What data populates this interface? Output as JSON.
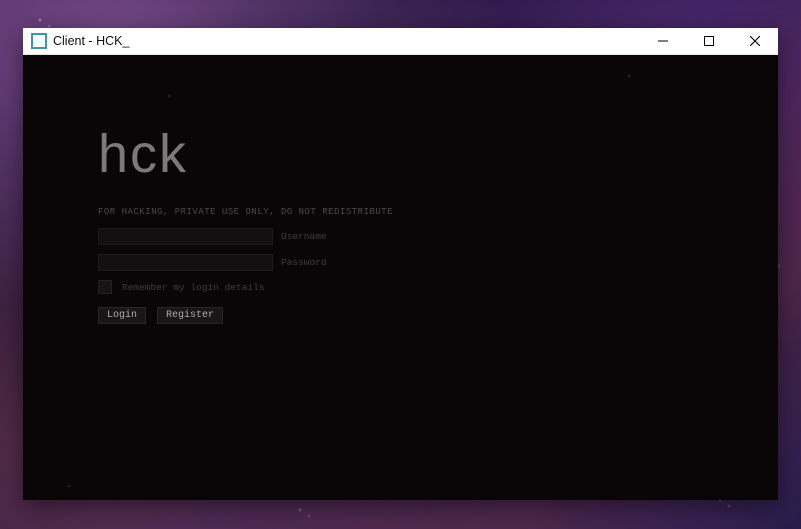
{
  "window": {
    "title": "Client - HCK_"
  },
  "login": {
    "logo": "hck",
    "tagline": "FOR HACKING, PRIVATE USE ONLY, DO NOT REDISTRIBUTE",
    "username": {
      "label": "Username",
      "value": ""
    },
    "password": {
      "label": "Password",
      "value": ""
    },
    "remember_label": "Remember my login details",
    "remember_checked": false,
    "buttons": {
      "login": "Login",
      "register": "Register"
    }
  }
}
